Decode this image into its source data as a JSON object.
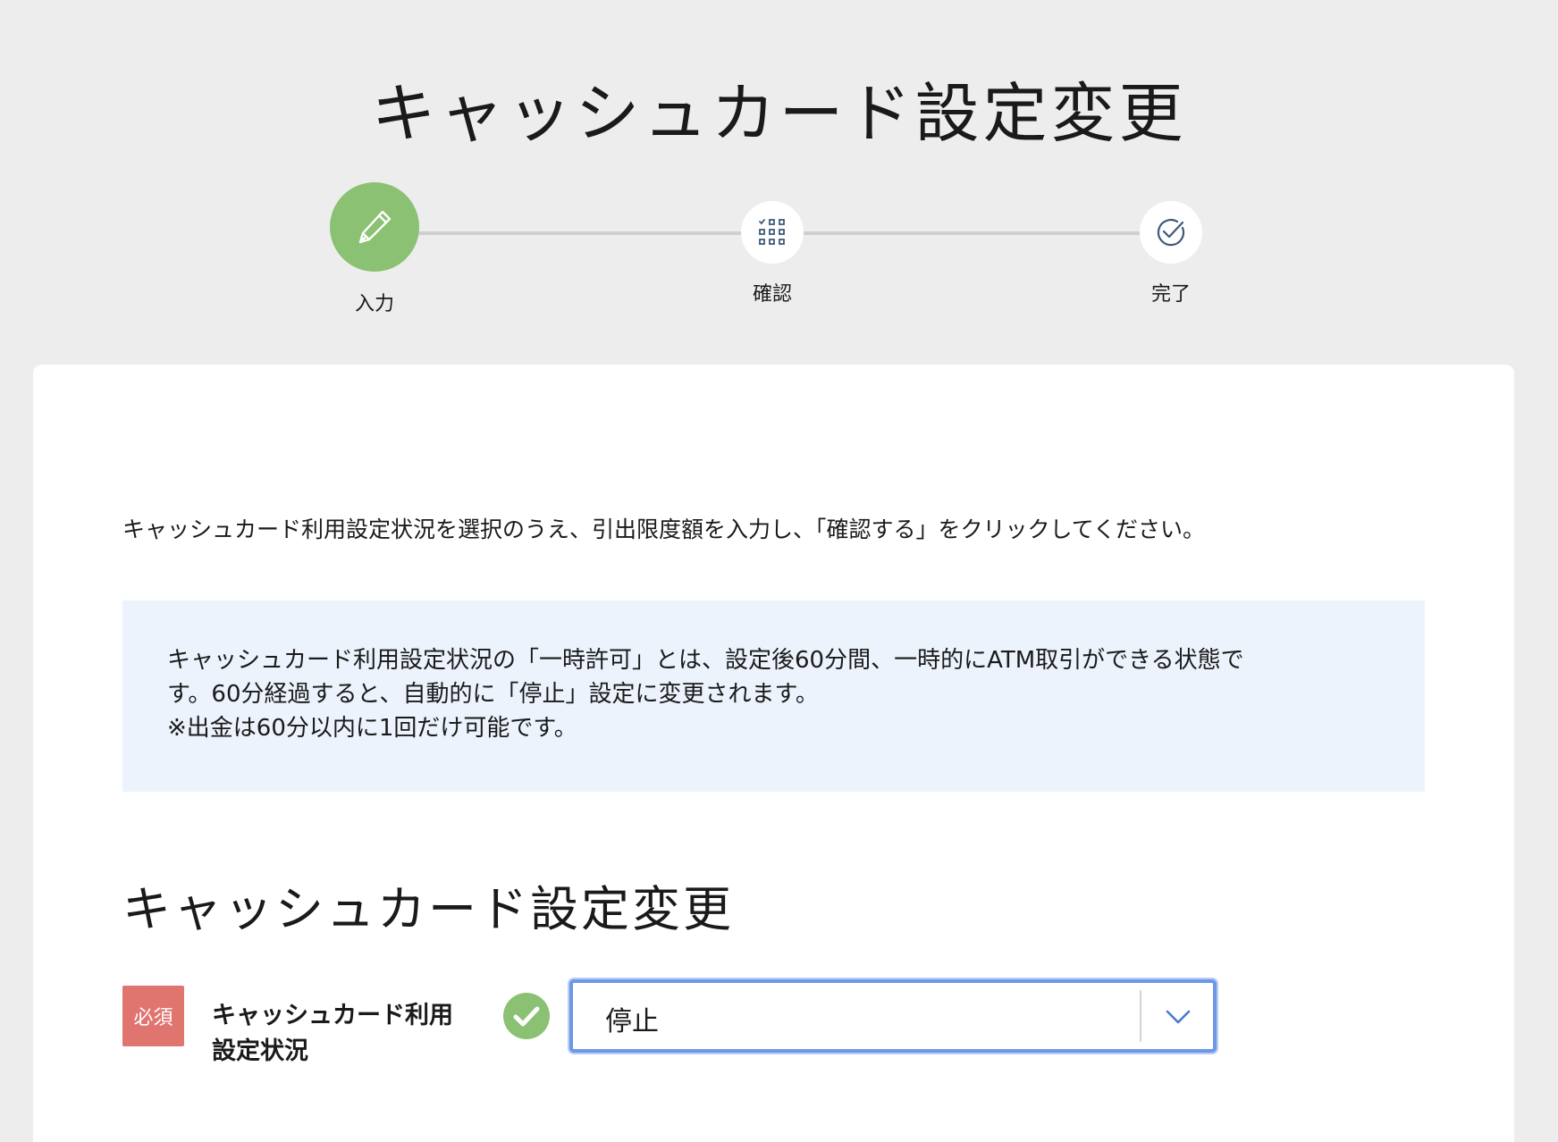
{
  "page_title": "キャッシュカード設定変更",
  "stepper": {
    "steps": [
      {
        "label": "入力",
        "icon": "pencil-icon",
        "state": "active"
      },
      {
        "label": "確認",
        "icon": "checklist-grid-icon",
        "state": "pending"
      },
      {
        "label": "完了",
        "icon": "check-circle-icon",
        "state": "pending"
      }
    ]
  },
  "instruction": "キャッシュカード利用設定状況を選択のうえ、引出限度額を入力し、「確認する」をクリックしてください。",
  "info_box": {
    "lines": [
      "キャッシュカード利用設定状況の「一時許可」とは、設定後60分間、一時的にATM取引ができる状態で",
      "す。60分経過すると、自動的に「停止」設定に変更されます。",
      "※出金は60分以内に1回だけ可能です。"
    ]
  },
  "section_title": "キャッシュカード設定変更",
  "form": {
    "required_label": "必須",
    "field_label_line1": "キャッシュカード利用",
    "field_label_line2": "設定状況",
    "select_value": "停止"
  },
  "colors": {
    "background": "#ededed",
    "active_step": "#8bc172",
    "required_badge": "#e07570",
    "info_box": "#ecf3fd",
    "focus_border": "#6f97e8",
    "valid_icon": "#8bc172"
  }
}
